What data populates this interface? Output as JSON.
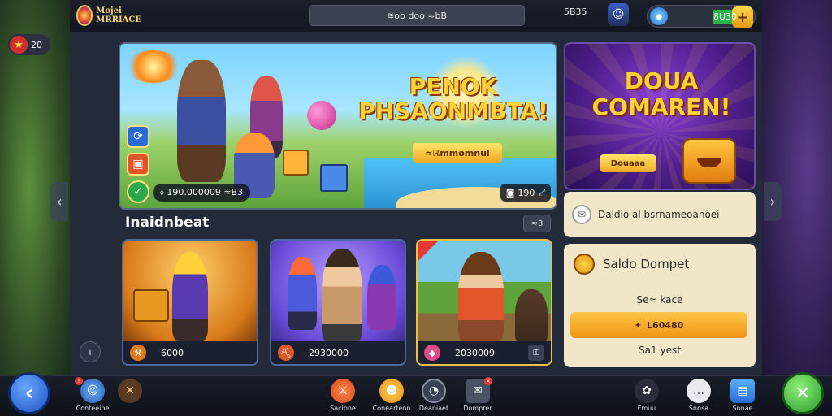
{
  "topbar": {
    "logo_line1": "Mojei",
    "logo_line2": "MRRIACE",
    "search_text": "≋ob doo ≈bB",
    "coins": "5B35",
    "gems": "8U30",
    "plus": "+"
  },
  "level": {
    "value": "20"
  },
  "hero": {
    "title": "PENOK PHSAONMBTA!",
    "subtitle": "≈ℝmmomnul",
    "stat": "⬨ 190.000009  ≈B3",
    "counter_value": "190",
    "icons": [
      "refresh-icon",
      "chest-icon",
      "check-icon"
    ]
  },
  "promo": {
    "title": "DOUA COMAREN!",
    "button": "Douaaa"
  },
  "notice": {
    "text": "Daldio al bsrnameoanoei"
  },
  "section": {
    "title": "Inaidnbeat",
    "more": "≈3"
  },
  "cards": [
    {
      "value": "6000",
      "icon": "shovel-icon"
    },
    {
      "value": "2930000",
      "icon": "pickaxe-icon"
    },
    {
      "value": "2030009",
      "icon": "gem-icon"
    }
  ],
  "wallet": {
    "title": "Saldo Dompet",
    "label": "Se≈ kace",
    "button": "L60480",
    "footer": "Sa1 yest"
  },
  "nav": [
    {
      "label": "Conteeibe",
      "icon": "character-icon"
    },
    {
      "label": "",
      "icon": "close-icon"
    },
    {
      "label": "Sacipne",
      "icon": "sword-icon"
    },
    {
      "label": "Coneartenn",
      "icon": "hero-icon"
    },
    {
      "label": "Deaniaet",
      "icon": "chat-icon"
    },
    {
      "label": "Domprer",
      "icon": "mail-icon"
    },
    {
      "label": "Fmuu",
      "icon": "gift-icon"
    },
    {
      "label": "Snnsa",
      "icon": "speech-icon"
    },
    {
      "label": "Snnae",
      "icon": "book-icon"
    }
  ]
}
